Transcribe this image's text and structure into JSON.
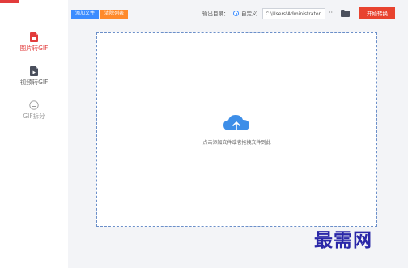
{
  "sidebar": {
    "items": [
      {
        "label": "图片转GIF",
        "icon": "image-file-icon",
        "state": "active",
        "color": "#e23c3c"
      },
      {
        "label": "视频转GIF",
        "icon": "video-file-icon",
        "state": "normal",
        "color": "#4a4f5c"
      },
      {
        "label": "GIF拆分",
        "icon": "gif-split-icon",
        "state": "normal",
        "color": "#9a9a9a"
      }
    ]
  },
  "toolbar": {
    "add_file_label": "添加文件",
    "clear_list_label": "清除列表",
    "output_dir_label": "输出目录：",
    "custom_option_label": "自定义",
    "custom_option_selected": true,
    "output_path": "C:\\Users\\Administrator",
    "more_label": "···",
    "folder_icon": "folder-icon",
    "start_label": "开始转换"
  },
  "drop_zone": {
    "icon": "cloud-upload-icon",
    "hint": "点击添加文件或者拖拽文件到此"
  },
  "watermark": {
    "text": "最需网",
    "color": "#2a27a8"
  },
  "colors": {
    "accent_blue": "#3b8cff",
    "accent_orange": "#ff8a2a",
    "start_red": "#e8432f",
    "active_red": "#e23c3c"
  }
}
